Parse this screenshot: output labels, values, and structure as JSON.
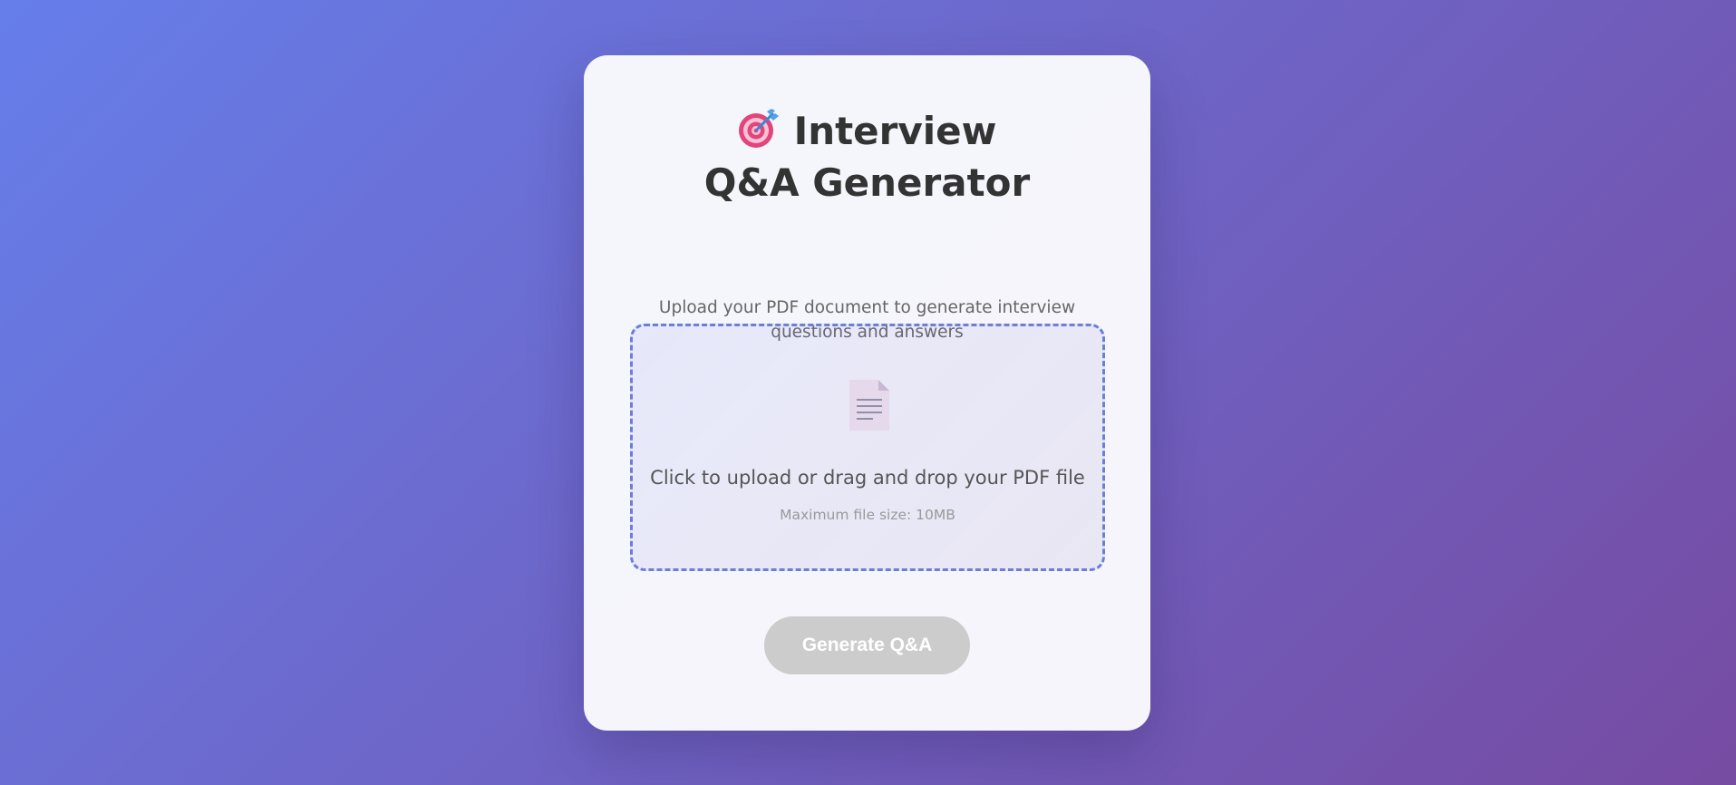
{
  "app": {
    "title": "Interview Q&A Generator",
    "title_icon": "target-icon",
    "subtitle": "Upload your PDF document to generate interview questions and answers"
  },
  "upload": {
    "icon": "document-icon",
    "primary_text": "Click to upload or drag and drop your PDF file",
    "hint_text": "Maximum file size: 10MB"
  },
  "actions": {
    "generate_label": "Generate Q&A",
    "generate_disabled": true
  },
  "colors": {
    "background_start": "#667eea",
    "background_end": "#764ba2",
    "upload_border": "#6b7fd7",
    "button_disabled": "#cccccc",
    "title_text": "#333333"
  }
}
